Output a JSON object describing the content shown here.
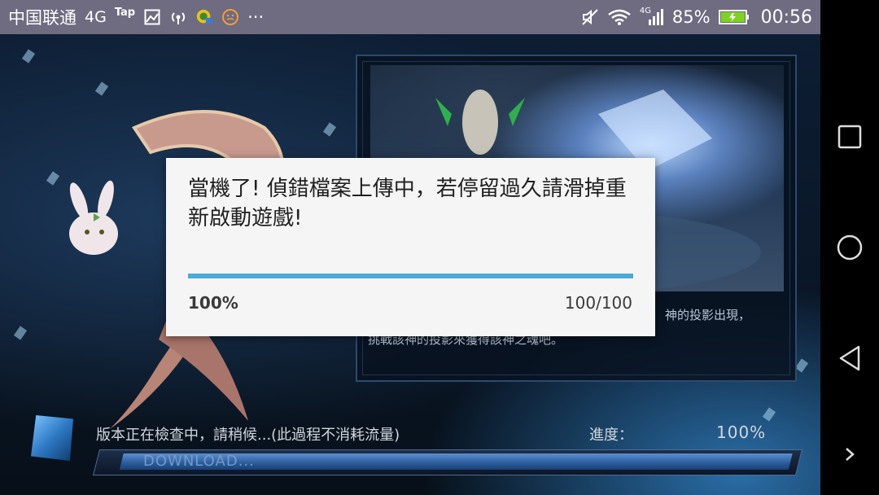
{
  "status_bar": {
    "carrier": "中国联通",
    "network": "4G",
    "tap_label": "Tap",
    "signal_tag": "4G",
    "battery_percent": "85%",
    "time": "00:56",
    "overflow": "···"
  },
  "game": {
    "panel_caption_line1": "神的投影出現，",
    "panel_caption_line2": "挑戰該神的投影來獲得該神之魂吧。",
    "status_text": "版本正在檢查中，請稍候...(此過程不消耗流量)",
    "progress_label": "進度：",
    "progress_value": "100%",
    "download_label": "DOWNLOAD..."
  },
  "dialog": {
    "message": "當機了! 偵錯檔案上傳中，若停留過久請滑掉重新啟動遊戲!",
    "percent_text": "100%",
    "count_text": "100/100",
    "progress": 1.0
  },
  "colors": {
    "status_bar_bg": "#6f6b80",
    "dialog_bg": "#f5f5f5",
    "progress_accent": "#4aaad8",
    "battery_green": "#7ed321"
  },
  "icons": [
    "image-icon",
    "hotspot-icon",
    "app-notification-icon",
    "face-icon",
    "mute-icon",
    "wifi-icon",
    "signal-icon",
    "battery-icon",
    "recent-apps-icon",
    "home-icon",
    "back-icon",
    "chevron-right-icon"
  ]
}
